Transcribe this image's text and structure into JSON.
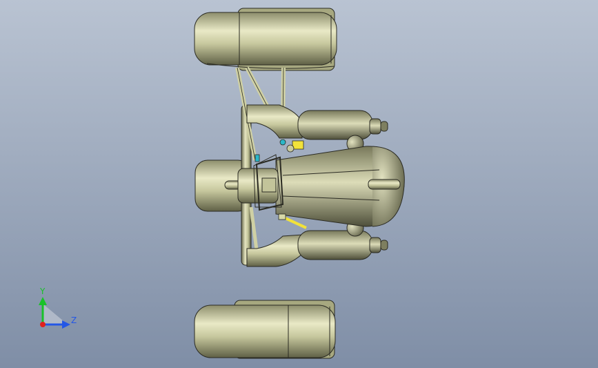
{
  "viewport": {
    "background_top": "#b9c3d2",
    "background_bottom": "#7f8ea6",
    "model": {
      "name": "vehicle-chassis-assembly",
      "body_color": "#cfd0a4",
      "shade_color": "#6f7052",
      "edge_color": "#2a2a22",
      "accent_yellow": "#f2e23a",
      "accent_cyan": "#2bb7c9"
    }
  },
  "triad": {
    "y_label": "Y",
    "z_label": "Z",
    "y_color": "#19c229",
    "z_color": "#2457e6",
    "x_color": "#e0211d"
  }
}
